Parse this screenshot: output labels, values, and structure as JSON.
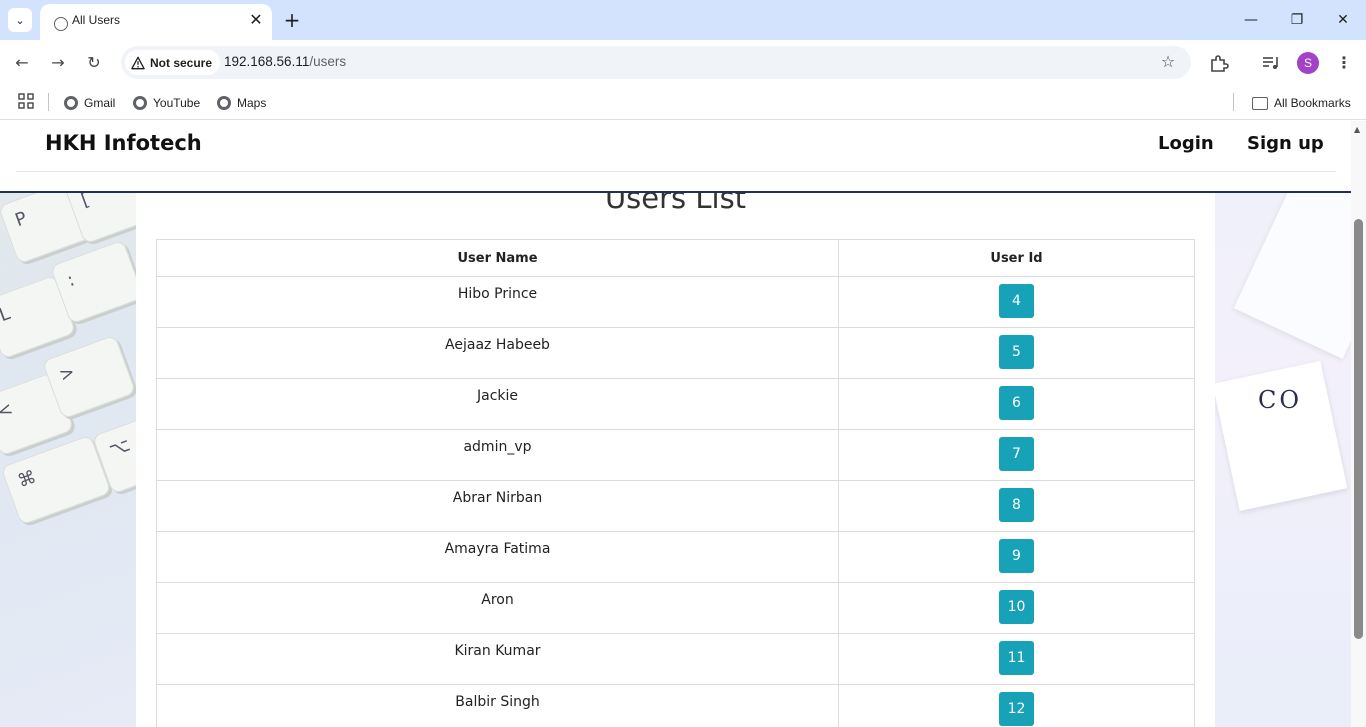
{
  "browser": {
    "tab_title": "All Users",
    "security_label": "Not secure",
    "url_host": "192.168.56.11",
    "url_path": "/users",
    "profile_initial": "S",
    "bookmarks": [
      "Gmail",
      "YouTube",
      "Maps"
    ],
    "all_bookmarks_label": "All Bookmarks"
  },
  "site": {
    "brand": "HKH Infotech",
    "nav": {
      "login": "Login",
      "signup": "Sign up"
    }
  },
  "page": {
    "title": "Users List",
    "table": {
      "headers": [
        "User Name",
        "User Id"
      ],
      "rows": [
        {
          "name": "Hibo Prince",
          "id": "4"
        },
        {
          "name": "Aejaaz Habeeb",
          "id": "5"
        },
        {
          "name": "Jackie",
          "id": "6"
        },
        {
          "name": "admin_vp",
          "id": "7"
        },
        {
          "name": "Abrar Nirban",
          "id": "8"
        },
        {
          "name": "Amayra Fatima",
          "id": "9"
        },
        {
          "name": "Aron",
          "id": "10"
        },
        {
          "name": "Kiran Kumar",
          "id": "11"
        },
        {
          "name": "Balbir Singh",
          "id": "12"
        }
      ]
    }
  },
  "decor": {
    "card_text": "CO"
  },
  "colors": {
    "badge": "#17a2b8",
    "header_border": "#1f3350",
    "tabstrip": "#d3e3fd"
  }
}
